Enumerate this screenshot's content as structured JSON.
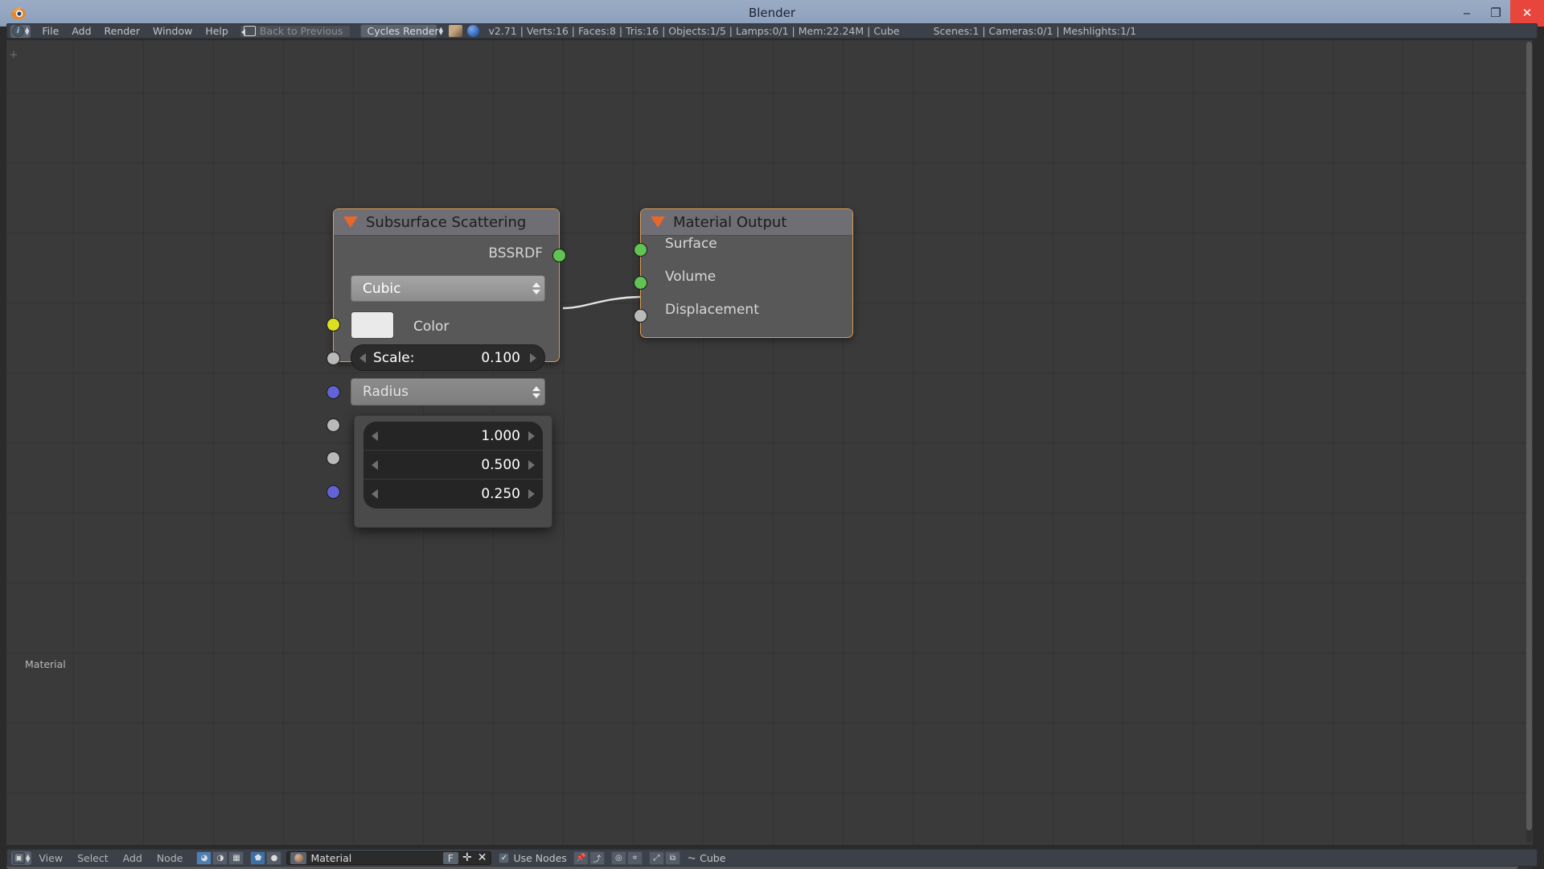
{
  "window": {
    "title": "Blender",
    "minimize": "‒",
    "maximize": "❐",
    "close": "✕",
    "app_icon_name": "blender-logo-icon"
  },
  "infobar": {
    "editor_type_icon": "info-editor-icon",
    "menus": [
      "File",
      "Add",
      "Render",
      "Window",
      "Help"
    ],
    "back_to_previous": "Back to Previous",
    "render_engine": "Cycles Render",
    "stats": "v2.71 | Verts:16 | Faces:8 | Tris:16 | Objects:1/5 | Lamps:0/1 | Mem:22.24M | Cube",
    "scene_stats": "Scenes:1 | Cameras:0/1 | Meshlights:1/1"
  },
  "canvas": {
    "material_label": "Material",
    "corner_plus": "+"
  },
  "nodes": [
    {
      "id": "subsurface-scattering",
      "title": "Subsurface Scattering",
      "output_socket_label": "BSSRDF",
      "falloff": "Cubic",
      "color_label": "Color",
      "scale_label": "Scale:",
      "scale_value": "0.100",
      "radius_label": "Radius",
      "sockets": [
        {
          "name": "bssrdf-output-socket",
          "color": "green"
        },
        {
          "name": "color-input-socket",
          "color": "yellow"
        },
        {
          "name": "scale-input-socket",
          "color": "grey"
        },
        {
          "name": "radius-input-socket",
          "color": "blue"
        },
        {
          "name": "texture-blur-input-socket",
          "color": "grey"
        },
        {
          "name": "sharpness-input-socket",
          "color": "grey"
        },
        {
          "name": "normal-input-socket",
          "color": "blue"
        }
      ]
    },
    {
      "id": "material-output",
      "title": "Material Output",
      "rows": [
        {
          "label": "Surface",
          "socket": "green"
        },
        {
          "label": "Volume",
          "socket": "green"
        },
        {
          "label": "Displacement",
          "socket": "grey"
        }
      ]
    }
  ],
  "radius_popup": {
    "values": [
      "1.000",
      "0.500",
      "0.250"
    ]
  },
  "bottombar": {
    "editor_icon": "node-editor-icon",
    "menus": [
      "View",
      "Select",
      "Add",
      "Node"
    ],
    "shader_type_icons": [
      "object-shader-icon",
      "world-shader-icon",
      "texture-shader-icon"
    ],
    "slot_icons": [
      "object-icon",
      "world-icon"
    ],
    "material_name": "Material",
    "material_f": "F",
    "material_add": "✛",
    "material_remove": "✕",
    "use_nodes": "Use Nodes",
    "use_nodes_checked": "✓",
    "pin_icon": "pin-icon",
    "go_parent_icon": "go-to-parent-icon",
    "snap_icon": "snap-icon",
    "overlay_icon": "overlay-icon",
    "object_name": "Cube"
  },
  "colors": {
    "accent_orange": "#e8662b",
    "node_border": "#d99b55",
    "socket_green": "#62c355",
    "socket_yellow": "#dede21",
    "socket_grey": "#b9b9b9",
    "socket_blue": "#6363d8",
    "titlebar": "#93a5c0",
    "canvas": "#3a3a3a",
    "close_red": "#e8453c"
  }
}
